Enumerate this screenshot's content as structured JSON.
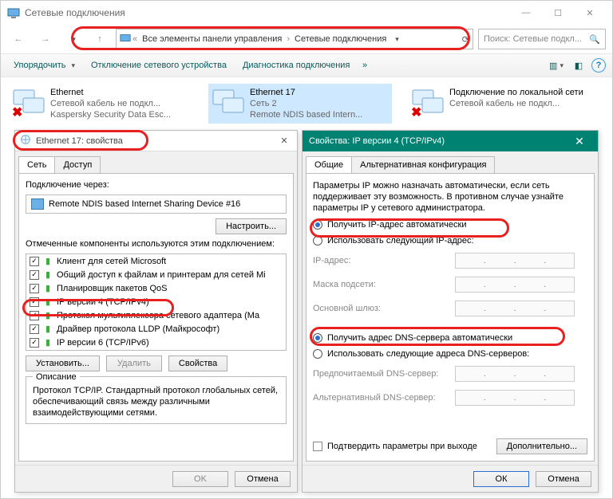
{
  "window": {
    "title": "Сетевые подключения",
    "min": "—",
    "max": "☐",
    "close": "✕"
  },
  "nav": {
    "back": "←",
    "fwd": "→",
    "up": "↑",
    "crumb_prefix": "«",
    "crumb1": "Все элементы панели управления",
    "crumb2": "Сетевые подключения",
    "search_placeholder": "Поиск: Сетевые подкл..."
  },
  "toolbar": {
    "organize": "Упорядочить",
    "disable": "Отключение сетевого устройства",
    "diag": "Диагностика подключения"
  },
  "adapters": [
    {
      "name": "Ethernet",
      "l2": "Сетевой кабель не подкл...",
      "l3": "Kaspersky Security Data Esc...",
      "disabled": true
    },
    {
      "name": "Ethernet 17",
      "l2": "Сеть 2",
      "l3": "Remote NDIS based Intern...",
      "disabled": false,
      "selected": true
    },
    {
      "name": "Подключение по локальной сети",
      "l2": "Сетевой кабель не подкл...",
      "l3": "",
      "disabled": true
    }
  ],
  "dlg1": {
    "title": "Ethernet 17: свойства",
    "tab_net": "Сеть",
    "tab_access": "Доступ",
    "connect_via": "Подключение через:",
    "device": "Remote NDIS based Internet Sharing Device #16",
    "configure": "Настроить...",
    "marked_components": "Отмеченные компоненты используются этим подключением:",
    "components": [
      "Клиент для сетей Microsoft",
      "Общий доступ к файлам и принтерам для сетей Mi",
      "Планировщик пакетов QoS",
      "IP версии 4 (TCP/IPv4)",
      "Протокол мультиплексора сетевого адаптера (Ма",
      "Драйвер протокола LLDP (Майкрософт)",
      "IP версии 6 (TCP/IPv6)"
    ],
    "install": "Установить...",
    "remove": "Удалить",
    "props": "Свойства",
    "desc_legend": "Описание",
    "desc_body": "Протокол TCP/IP. Стандартный протокол глобальных сетей, обеспечивающий связь между различными взаимодействующими сетями.",
    "ok": "OK",
    "cancel": "Отмена"
  },
  "dlg2": {
    "title": "Свойства: IP версии 4 (TCP/IPv4)",
    "tab_general": "Общие",
    "tab_alt": "Альтернативная конфигурация",
    "intro": "Параметры IP можно назначать автоматически, если сеть поддерживает эту возможность. В противном случае узнайте параметры IP у сетевого администратора.",
    "r_ip_auto": "Получить IP-адрес автоматически",
    "r_ip_manual": "Использовать следующий IP-адрес:",
    "f_ip": "IP-адрес:",
    "f_mask": "Маска подсети:",
    "f_gw": "Основной шлюз:",
    "r_dns_auto": "Получить адрес DNS-сервера автоматически",
    "r_dns_manual": "Использовать следующие адреса DNS-серверов:",
    "f_dns1": "Предпочитаемый DNS-сервер:",
    "f_dns2": "Альтернативный DNS-сервер:",
    "confirm_exit": "Подтвердить параметры при выходе",
    "advanced": "Дополнительно...",
    "ok": "ОК",
    "cancel": "Отмена"
  }
}
